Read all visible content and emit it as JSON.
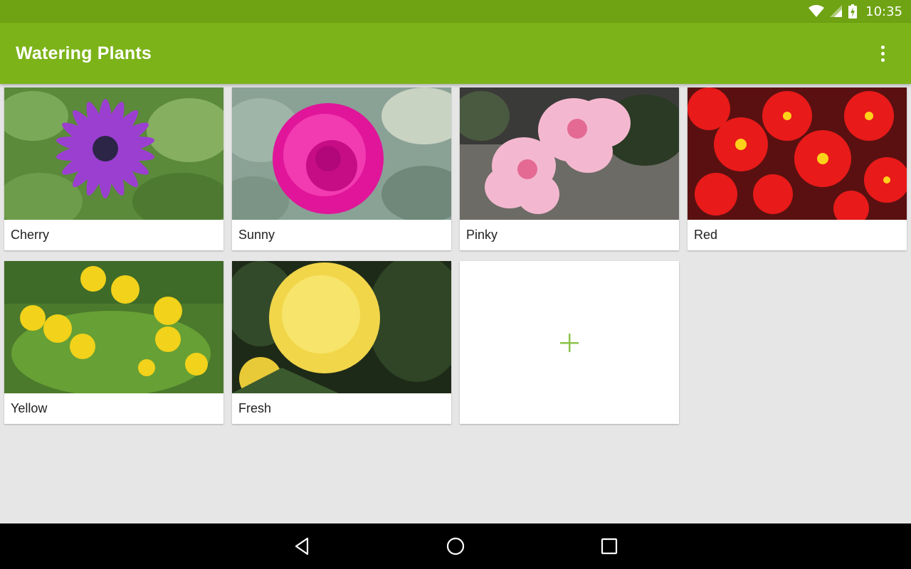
{
  "status_bar": {
    "time": "10:35"
  },
  "app_bar": {
    "title": "Watering Plants",
    "menu_icon": "overflow-menu-icon"
  },
  "plants": [
    {
      "name": "Cherry",
      "image": "purple-daisy"
    },
    {
      "name": "Sunny",
      "image": "pink-peony"
    },
    {
      "name": "Pinky",
      "image": "light-pink-flowers"
    },
    {
      "name": "Red",
      "image": "red-begonias"
    },
    {
      "name": "Yellow",
      "image": "yellow-lilies"
    },
    {
      "name": "Fresh",
      "image": "yellow-marigold"
    }
  ],
  "add_card": {
    "icon": "plus-icon"
  },
  "nav_bar": {
    "icons": [
      "back-icon",
      "home-icon",
      "recents-icon"
    ]
  },
  "colors": {
    "status_bar": "#6fa313",
    "app_bar": "#7cb319",
    "accent": "#8bc34a",
    "background": "#e6e6e6"
  }
}
